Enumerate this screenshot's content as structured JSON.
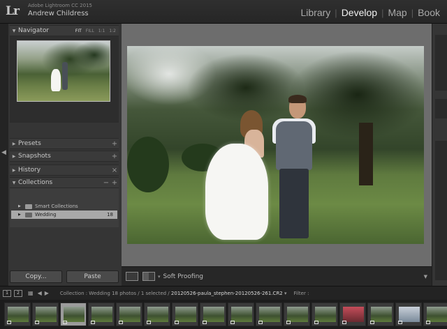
{
  "app": {
    "logo": "Lr",
    "product": "Adobe Lightroom CC 2015",
    "user": "Andrew Childress"
  },
  "modules": [
    {
      "label": "Library",
      "active": false
    },
    {
      "label": "Develop",
      "active": true
    },
    {
      "label": "Map",
      "active": false
    },
    {
      "label": "Book",
      "active": false
    }
  ],
  "left_panel": {
    "navigator": {
      "title": "Navigator",
      "zoom": [
        "FIT",
        "FILL",
        "1:1",
        "1:2"
      ],
      "active_zoom": "FIT"
    },
    "presets": {
      "title": "Presets",
      "action": "+"
    },
    "snapshots": {
      "title": "Snapshots",
      "action": "+"
    },
    "history": {
      "title": "History",
      "action": "×"
    },
    "collections": {
      "title": "Collections",
      "actions": [
        "−",
        "+"
      ],
      "items": [
        {
          "label": "Smart Collections",
          "count": ""
        },
        {
          "label": "Wedding",
          "count": "18"
        }
      ]
    },
    "buttons": {
      "copy": "Copy...",
      "paste": "Paste"
    }
  },
  "toolbar": {
    "soft_proofing": "Soft Proofing"
  },
  "filmstrip_bar": {
    "monitors": [
      "1",
      "2"
    ],
    "path_prefix": "Collection : Wedding",
    "path_middle": "18 photos / 1 selected /",
    "file": "20120526-paula_stephen-20120526-261.CR2",
    "filter_label": "Filter :"
  },
  "filmstrip": {
    "count": 16,
    "selected_index": 2
  },
  "colors": {
    "accent_active_module": "#f0f0f0",
    "panel": "#353535",
    "canvas": "#6d6d6d"
  }
}
